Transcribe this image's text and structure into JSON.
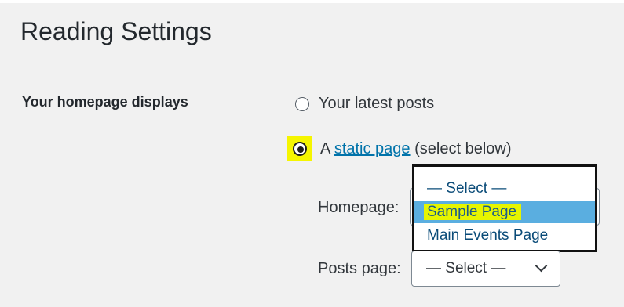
{
  "page": {
    "title": "Reading Settings"
  },
  "homepage_displays": {
    "label": "Your homepage displays",
    "option_latest": "Your latest posts",
    "option_static_prefix": "A",
    "option_static_link": "static page",
    "option_static_suffix": "(select below)",
    "selected": "static page"
  },
  "homepage_field": {
    "label": "Homepage:",
    "dropdown_options": [
      "— Select —",
      "Sample Page",
      "Main Events Page"
    ],
    "highlighted_option": "Sample Page"
  },
  "posts_page_field": {
    "label": "Posts page:",
    "value": "— Select —"
  },
  "colors": {
    "highlight_yellow": "#f5f500",
    "option_hover_blue": "#5aaee0",
    "link_blue": "#0073aa"
  }
}
